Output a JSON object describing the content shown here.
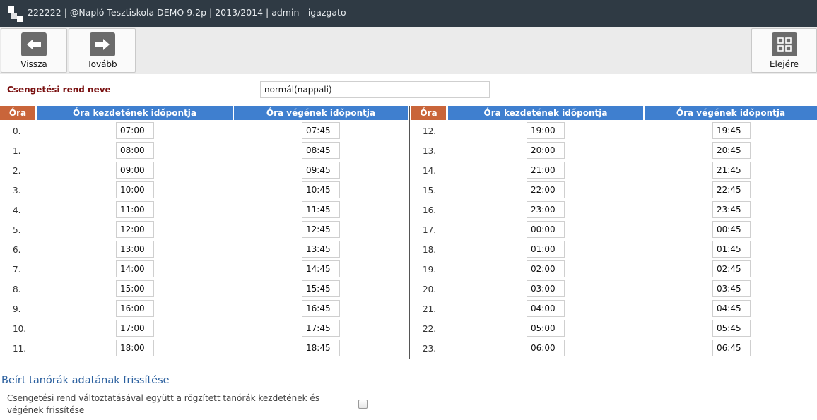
{
  "window": {
    "title": "222222 | @Napló Tesztiskola DEMO 9.2p | 2013/2014 |  admin - igazgato"
  },
  "toolbar": {
    "back_label": "Vissza",
    "next_label": "Tovább",
    "top_label": "Elejére"
  },
  "form": {
    "name_label": "Csengetési rend neve",
    "name_value": "normál(nappali)"
  },
  "table": {
    "headers": {
      "period": "Óra",
      "start": "Óra kezdetének időpontja",
      "end": "Óra végének időpontja"
    },
    "rows": [
      {
        "period": "0.",
        "start": "07:00",
        "end": "07:45"
      },
      {
        "period": "1.",
        "start": "08:00",
        "end": "08:45"
      },
      {
        "period": "2.",
        "start": "09:00",
        "end": "09:45"
      },
      {
        "period": "3.",
        "start": "10:00",
        "end": "10:45"
      },
      {
        "period": "4.",
        "start": "11:00",
        "end": "11:45"
      },
      {
        "period": "5.",
        "start": "12:00",
        "end": "12:45"
      },
      {
        "period": "6.",
        "start": "13:00",
        "end": "13:45"
      },
      {
        "period": "7.",
        "start": "14:00",
        "end": "14:45"
      },
      {
        "period": "8.",
        "start": "15:00",
        "end": "15:45"
      },
      {
        "period": "9.",
        "start": "16:00",
        "end": "16:45"
      },
      {
        "period": "10.",
        "start": "17:00",
        "end": "17:45"
      },
      {
        "period": "11.",
        "start": "18:00",
        "end": "18:45"
      },
      {
        "period": "12.",
        "start": "19:00",
        "end": "19:45"
      },
      {
        "period": "13.",
        "start": "20:00",
        "end": "20:45"
      },
      {
        "period": "14.",
        "start": "21:00",
        "end": "21:45"
      },
      {
        "period": "15.",
        "start": "22:00",
        "end": "22:45"
      },
      {
        "period": "16.",
        "start": "23:00",
        "end": "23:45"
      },
      {
        "period": "17.",
        "start": "00:00",
        "end": "00:45"
      },
      {
        "period": "18.",
        "start": "01:00",
        "end": "01:45"
      },
      {
        "period": "19.",
        "start": "02:00",
        "end": "02:45"
      },
      {
        "period": "20.",
        "start": "03:00",
        "end": "03:45"
      },
      {
        "period": "21.",
        "start": "04:00",
        "end": "04:45"
      },
      {
        "period": "22.",
        "start": "05:00",
        "end": "05:45"
      },
      {
        "period": "23.",
        "start": "06:00",
        "end": "06:45"
      }
    ]
  },
  "update_section": {
    "title": "Beírt tanórák adatának frissítése",
    "description": "Csengetési rend változtatásával együtt a rögzített tanórák kezdetének és végének frissítése",
    "checked": false
  },
  "colors": {
    "titlebar": "#2f3a44",
    "header_orange": "#c9653a",
    "header_blue": "#3f7fcf",
    "label_red": "#7a1111",
    "section_blue": "#2a5f9e"
  }
}
